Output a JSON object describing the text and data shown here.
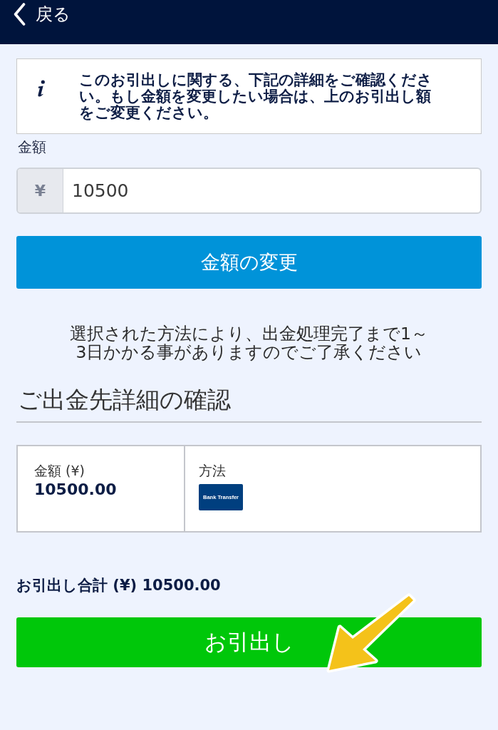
{
  "header": {
    "back_label": "戻る"
  },
  "notice": {
    "text": "このお引出しに関する、下記の詳細をご確認ください。もし金額を変更したい場合は、上のお引出し額をご変更ください。"
  },
  "amount_field": {
    "label": "金額",
    "prefix": "¥",
    "value": "10500"
  },
  "change_button": "金額の変更",
  "processing_note": "選択された方法により、出金処理完了まで1～3日かかる事がありますのでご了承ください",
  "details": {
    "title": "ご出金先詳細の確認",
    "amount_label": "金額 (¥)",
    "amount_value": "10500.00",
    "method_label": "方法",
    "method_logo": "Bank Transfer"
  },
  "total": "お引出し合計 (¥) 10500.00",
  "withdraw_button": "お引出し"
}
